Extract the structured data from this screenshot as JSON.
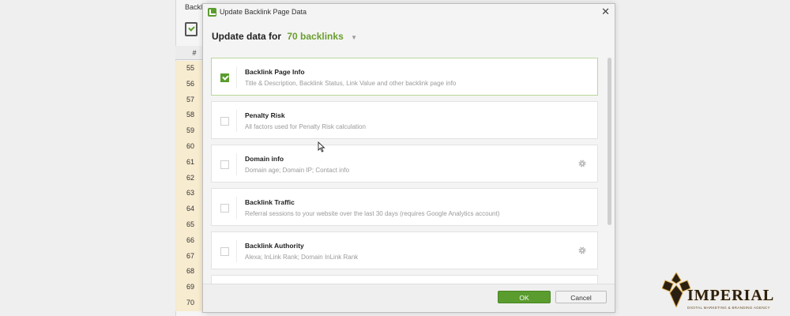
{
  "background_app": {
    "title": "Backlin",
    "column_header": "#",
    "row_numbers": [
      "55",
      "56",
      "57",
      "58",
      "59",
      "60",
      "61",
      "62",
      "63",
      "64",
      "65",
      "66",
      "67",
      "68",
      "69",
      "70"
    ]
  },
  "dialog": {
    "title": "Update Backlink Page Data",
    "header_prefix": "Update data for",
    "header_count": "70 backlinks",
    "items": [
      {
        "name": "Backlink Page Info",
        "description": "Title & Description, Backlink Status, Link Value and other backlink page info",
        "checked": true,
        "has_settings": false
      },
      {
        "name": "Penalty Risk",
        "description": "All factors used for Penalty Risk calculation",
        "checked": false,
        "has_settings": false
      },
      {
        "name": "Domain info",
        "description": "Domain age; Domain IP; Contact info",
        "checked": false,
        "has_settings": true
      },
      {
        "name": "Backlink Traffic",
        "description": "Referral sessions to your website over the last 30 days (requires Google Analytics account)",
        "checked": false,
        "has_settings": false
      },
      {
        "name": "Backlink Authority",
        "description": "Alexa; InLink Rank; Domain InLink Rank",
        "checked": false,
        "has_settings": true
      }
    ],
    "ok_label": "OK",
    "cancel_label": "Cancel"
  },
  "logo": {
    "wordmark": "IMPERIAL",
    "tagline": "DIGITAL MARKETING & BRANDING AGENCY"
  },
  "colors": {
    "accent": "#5a9c2e",
    "count_text": "#6a9e2f",
    "row_highlight": "#f7ebd0"
  }
}
